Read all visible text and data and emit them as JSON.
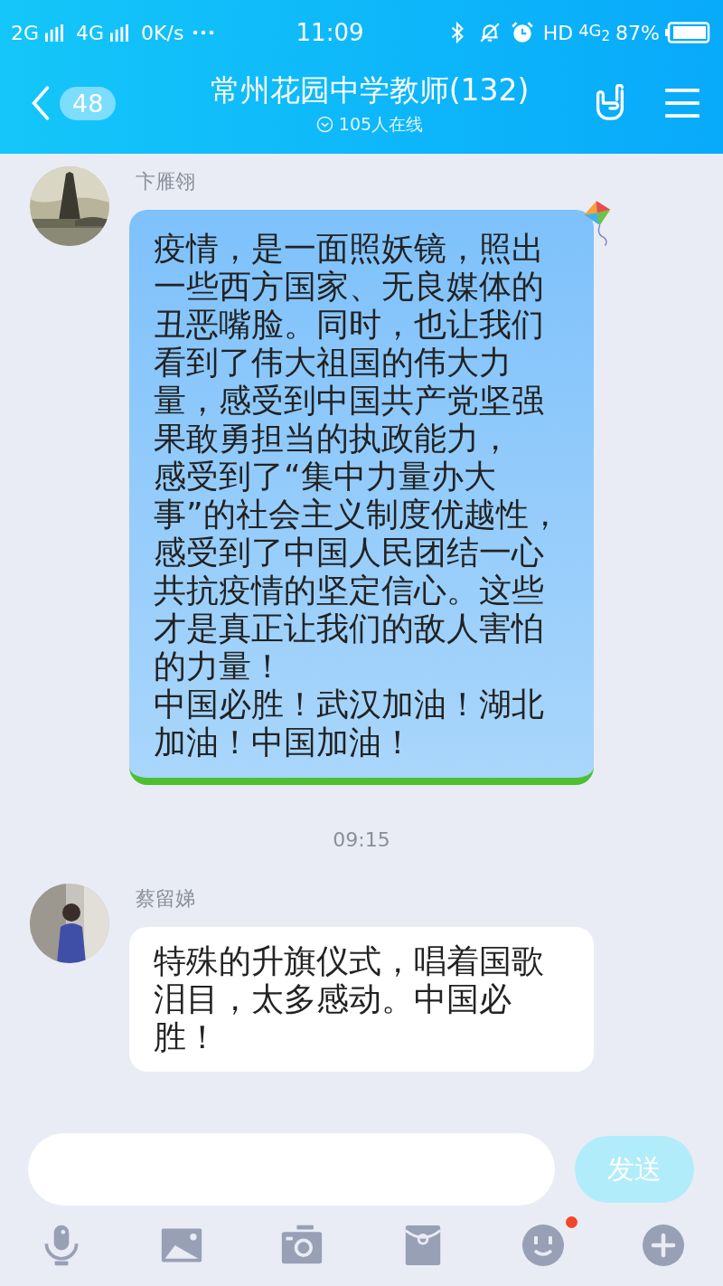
{
  "status_bar": {
    "network_1": "2G",
    "network_2": "4G",
    "speed": "0K/s",
    "time": "11:09",
    "hd": "HD",
    "network_3": "4G$_{2}$",
    "battery": "87%"
  },
  "header": {
    "unread": "48",
    "title": "常州花园中学教师(132)",
    "online": "105人在线"
  },
  "messages": [
    {
      "kind": "themed_message",
      "sender": "卞雁翎",
      "paragraphs": [
        "疫情，是一面照妖镜，照出一些西方国家、无良媒体的丑恶嘴脸。同时，也让我们看到了伟大祖国的伟大力量，感受到中国共产党坚强果敢勇担当的执政能力，",
        "感受到了“集中力量办大事”的社会主义制度优越性，感受到了中国人民团结一心共抗疫情的坚定信心。这些才是真正让我们的敌人害怕的力量！",
        "中国必胜！武汉加油！湖北加油！中国加油！"
      ]
    },
    {
      "kind": "time",
      "text": "09:15"
    },
    {
      "kind": "message",
      "sender": "蔡留娣",
      "paragraphs": [
        "特殊的升旗仪式，唱着国歌泪目，太多感动。中国必胜！"
      ]
    }
  ],
  "composer": {
    "send": "发送"
  },
  "toolbar": {
    "emoji_badge": true
  }
}
